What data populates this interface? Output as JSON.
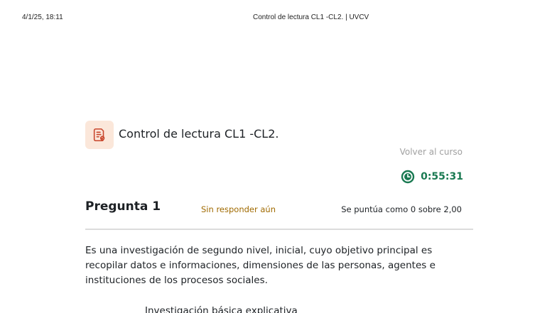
{
  "print_header": {
    "date": "4/1/25, 18:11",
    "title": "Control de lectura CL1  -CL2. | UVCV"
  },
  "activity": {
    "icon": "quiz-document-icon",
    "icon_bg_color": "#fbe7da",
    "icon_color": "#c8452b",
    "title": "Control de lectura CL1 -CL2.",
    "back_link": "Volver al curso"
  },
  "timer": {
    "icon": "clock-icon",
    "value": "0:55:31",
    "color": "#1a7a52"
  },
  "question": {
    "title": "Pregunta 1",
    "state": "Sin responder aún",
    "grade": "Se puntúa como 0 sobre 2,00",
    "text": "Es una investigación de segundo nivel, inicial, cuyo objetivo principal es recopilar datos e informaciones, dimensiones de las personas, agentes e instituciones de los procesos sociales.",
    "options": [
      "Investigación básica explicativa"
    ]
  }
}
